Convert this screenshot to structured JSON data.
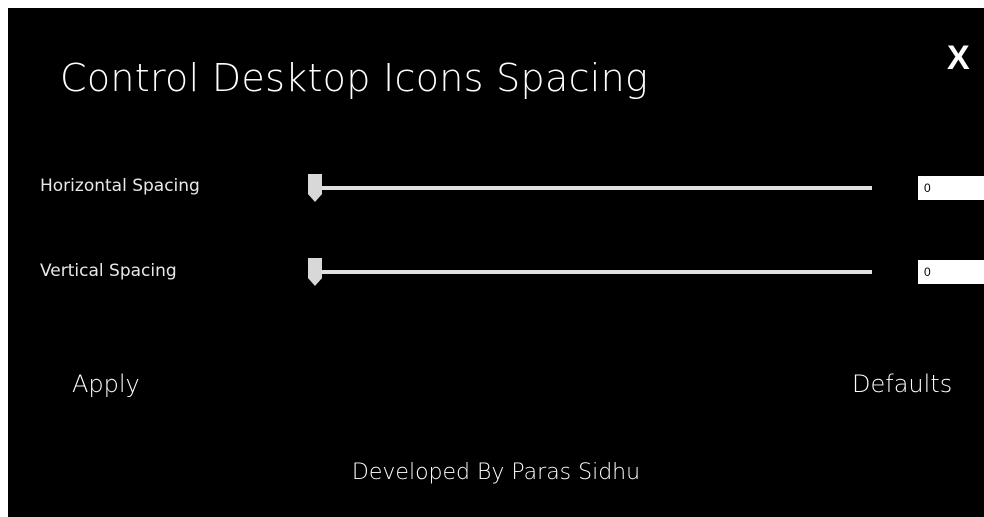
{
  "window": {
    "title": "Control Desktop Icons Spacing",
    "close_label": "X"
  },
  "settings": {
    "horizontal": {
      "label": "Horizontal Spacing",
      "value": "0",
      "level": 0
    },
    "vertical": {
      "label": "Vertical Spacing",
      "value": "0",
      "level": 0
    }
  },
  "actions": {
    "apply_label": "Apply",
    "defaults_label": "Defaults"
  },
  "footer": {
    "credit": "Developed By Paras Sidhu"
  },
  "colors": {
    "background": "#000000",
    "text": "#ffffff",
    "slider_track": "#e0e0e0"
  }
}
